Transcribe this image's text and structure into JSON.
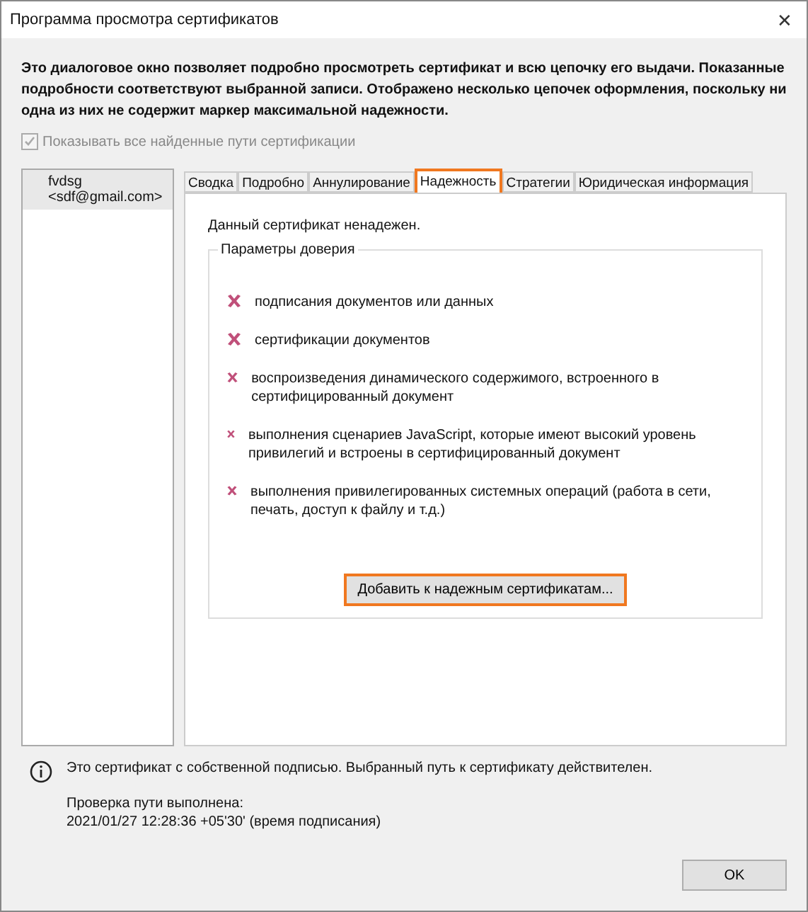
{
  "window": {
    "title": "Программа просмотра сертификатов",
    "close": "✕"
  },
  "intro": "Это диалоговое окно позволяет подробно просмотреть сертификат и всю цепочку его выдачи. Показанные подробности соответствуют выбранной записи. Отображено несколько цепочек оформления, поскольку ни одна из них не содержит маркер максимальной надежности.",
  "show_all_paths": {
    "label": "Показывать все найденные пути сертификации",
    "checked": true,
    "disabled": true
  },
  "chain": [
    {
      "label": "fvdsg <sdf@gmail.com>",
      "selected": true
    }
  ],
  "tabs": [
    {
      "label": "Сводка",
      "selected": false,
      "highlighted": false
    },
    {
      "label": "Подробно",
      "selected": false,
      "highlighted": false
    },
    {
      "label": "Аннулирование",
      "selected": false,
      "highlighted": false
    },
    {
      "label": "Надежность",
      "selected": true,
      "highlighted": true
    },
    {
      "label": "Стратегии",
      "selected": false,
      "highlighted": false
    },
    {
      "label": "Юридическая информация",
      "selected": false,
      "highlighted": false
    }
  ],
  "status": "Данный сертификат ненадежен.",
  "trust_group": {
    "title": "Параметры доверия",
    "items": [
      {
        "label": "подписания документов или данных",
        "allowed": false
      },
      {
        "label": "сертификации документов",
        "allowed": false
      },
      {
        "label": "воспроизведения динамического содержимого, встроенного в сертифицированный документ",
        "allowed": false
      },
      {
        "label": "выполнения сценариев JavaScript, которые имеют высокий уровень привилегий и встроены в сертифицированный документ",
        "allowed": false
      },
      {
        "label": "выполнения привилегированных системных операций (работа в сети, печать, доступ к файлу и т.д.)",
        "allowed": false
      }
    ]
  },
  "add_button": {
    "label": "Добавить к надежным сертификатам...",
    "highlighted": true
  },
  "info": {
    "message": "Это сертификат с собственной подписью. Выбранный путь к сертификату действителен.",
    "check_label": "Проверка пути выполнена:",
    "check_time": "2021/01/27 12:28:36 +05'30' (время подписания)"
  },
  "ok_button": "OK"
}
